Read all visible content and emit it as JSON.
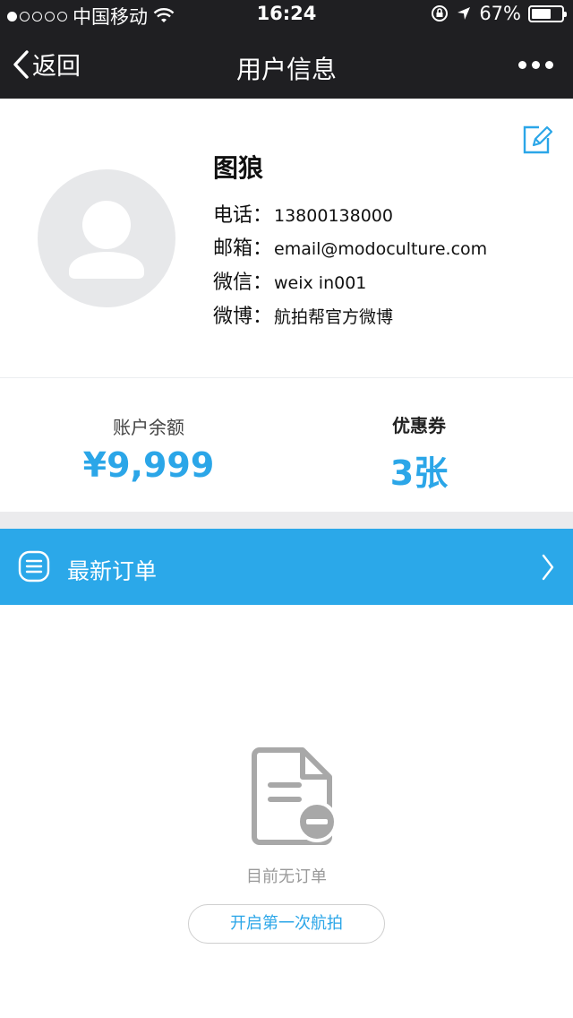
{
  "status_bar": {
    "carrier": "中国移动",
    "time": "16:24",
    "battery": "67%",
    "battery_level": 0.67
  },
  "nav": {
    "back_label": "返回",
    "title": "用户信息"
  },
  "profile": {
    "name": "图狼",
    "phone_label": "电话：",
    "phone": "13800138000",
    "email_label": "邮箱：",
    "email": "email@modoculture.com",
    "wechat_label": "微信：",
    "wechat": "weix in001",
    "weibo_label": "微博：",
    "weibo": "航拍帮官方微博"
  },
  "stats": {
    "balance_label": "账户余额",
    "balance_value": "¥9,999",
    "coupon_label": "优惠券",
    "coupon_value": "3张"
  },
  "orders": {
    "header_label": "最新订单",
    "empty_text": "目前无订单",
    "start_button": "开启第一次航拍"
  },
  "colors": {
    "accent": "#2ba8e9",
    "bar": "#1f1f22"
  },
  "icons": {
    "back": "chevron-left-icon",
    "more": "more-dots-icon",
    "edit": "edit-icon",
    "avatar": "user-placeholder-icon",
    "list": "list-icon",
    "forward": "chevron-right-icon",
    "empty": "no-document-icon"
  }
}
